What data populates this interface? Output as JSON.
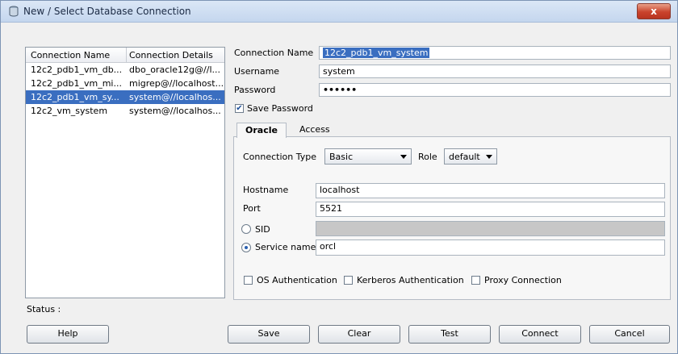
{
  "window": {
    "title": "New / Select Database Connection",
    "close_label": "x"
  },
  "connections": {
    "headers": [
      "Connection Name",
      "Connection Details"
    ],
    "rows": [
      {
        "name": "12c2_pdb1_vm_db...",
        "details": "dbo_oracle12g@//l...",
        "selected": false
      },
      {
        "name": "12c2_pdb1_vm_mi...",
        "details": "migrep@//localhost...",
        "selected": false
      },
      {
        "name": "12c2_pdb1_vm_sy...",
        "details": "system@//localhos...",
        "selected": true
      },
      {
        "name": "12c2_vm_system",
        "details": "system@//localhos...",
        "selected": false
      }
    ]
  },
  "status_label": "Status :",
  "form": {
    "connection_name_label": "Connection Name",
    "connection_name_value": "12c2_pdb1_vm_system",
    "username_label": "Username",
    "username_value": "system",
    "password_label": "Password",
    "password_value": "••••••",
    "save_password_label": "Save Password",
    "save_password_checked": true
  },
  "tabs": {
    "oracle": "Oracle",
    "access": "Access"
  },
  "oracle": {
    "connection_type_label": "Connection Type",
    "connection_type_value": "Basic",
    "role_label": "Role",
    "role_value": "default",
    "hostname_label": "Hostname",
    "hostname_value": "localhost",
    "port_label": "Port",
    "port_value": "5521",
    "sid_label": "SID",
    "sid_value": "",
    "service_name_label": "Service name",
    "service_name_value": "orcl",
    "os_auth_label": "OS Authentication",
    "kerberos_label": "Kerberos Authentication",
    "proxy_label": "Proxy Connection"
  },
  "buttons": {
    "help": "Help",
    "save": "Save",
    "clear": "Clear",
    "test": "Test",
    "connect": "Connect",
    "cancel": "Cancel"
  }
}
